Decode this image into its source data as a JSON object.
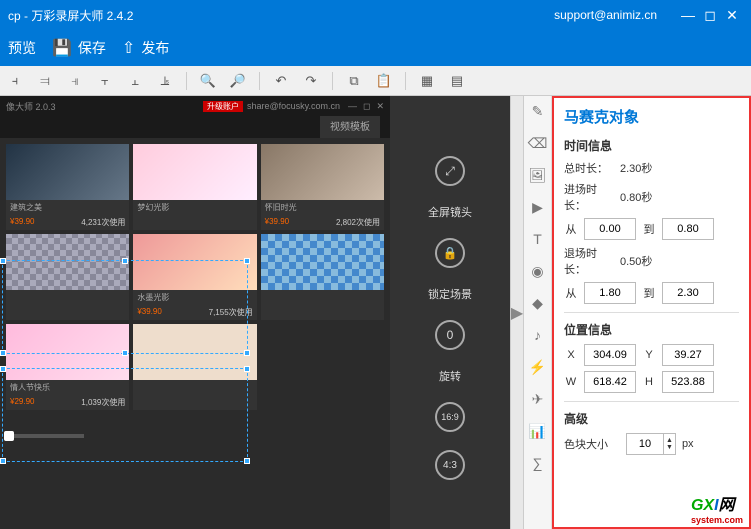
{
  "titlebar": {
    "title": "cp - 万彩录屏大师 2.4.2",
    "support": "support@animiz.cn"
  },
  "menubar": {
    "preview": "预览",
    "save": "保存",
    "publish": "发布"
  },
  "sidecol": {
    "fullscreen": "全屏镜头",
    "lock": "锁定场景",
    "rotate": "旋转",
    "rotate_val": "0",
    "ratio1": "16:9",
    "ratio2": "4:3"
  },
  "canvas": {
    "header_left": "像大师 2.0.3",
    "header_badge": "升级账户",
    "header_right": "share@focusky.com.cn",
    "tab": "视频模板",
    "cards": [
      {
        "name": "建筑之美",
        "price": "¥39.90",
        "stats": "4,231次使用"
      },
      {
        "name": "梦幻光影",
        "price": "",
        "stats": ""
      },
      {
        "name": "怀旧时光",
        "price": "¥39.90",
        "stats": "2,802次使用"
      },
      {
        "name": "",
        "price": "",
        "stats": ""
      },
      {
        "name": "水墨光影",
        "price": "¥39.90",
        "stats": "7,155次使用"
      },
      {
        "name": "",
        "price": "",
        "stats": ""
      },
      {
        "name": "情人节快乐",
        "price": "¥29.90",
        "stats": "1,039次使用"
      }
    ]
  },
  "panel": {
    "title": "马赛克对象",
    "sec_time": "时间信息",
    "total_label": "总时长：",
    "total_val": "2.30秒",
    "enter_label": "进场时长：",
    "enter_val": "0.80秒",
    "exit_label": "退场时长：",
    "exit_val": "0.50秒",
    "from": "从",
    "to": "到",
    "enter_from": "0.00",
    "enter_to": "0.80",
    "exit_from": "1.80",
    "exit_to": "2.30",
    "sec_pos": "位置信息",
    "x": "304.09",
    "y": "39.27",
    "w": "618.42",
    "h": "523.88",
    "sec_adv": "高级",
    "block_label": "色块大小",
    "block_val": "10",
    "unit": "px"
  },
  "watermark": {
    "gx": "GX",
    "i": "I",
    "net": "网",
    "sys": "system.com"
  }
}
